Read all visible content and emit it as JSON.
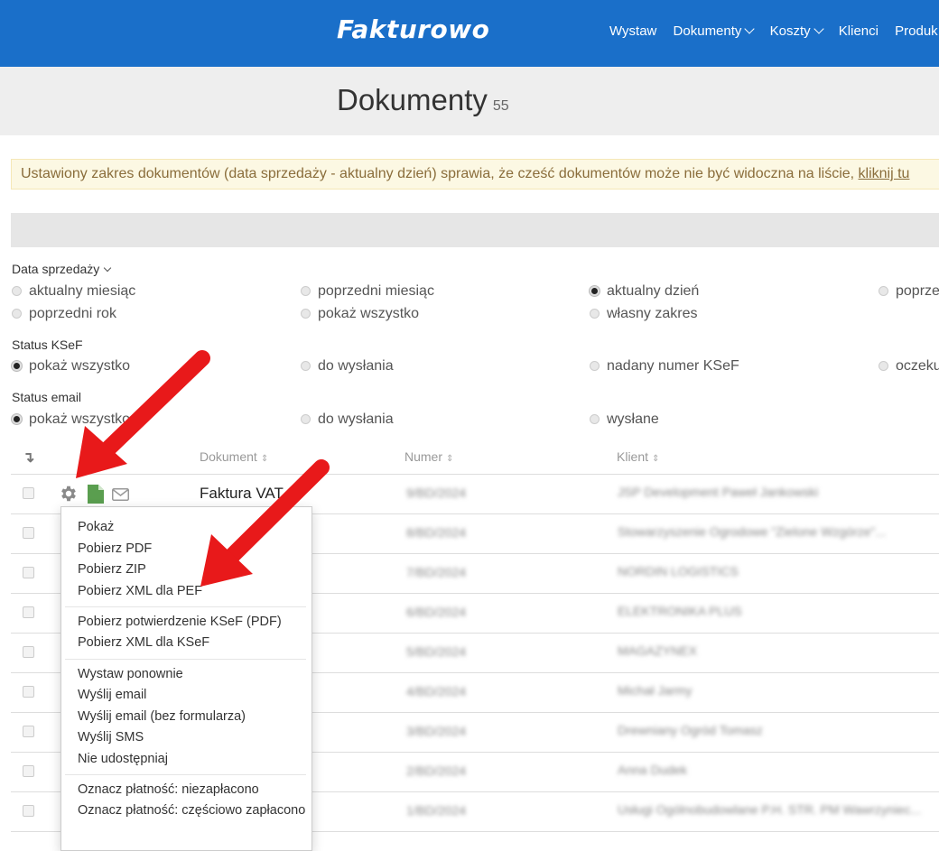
{
  "header": {
    "logo": "Fakturowo",
    "nav": [
      "Wystaw",
      "Dokumenty",
      "Koszty",
      "Klienci",
      "Produk"
    ]
  },
  "page": {
    "title": "Dokumenty",
    "count": "55"
  },
  "alert": {
    "text": "Ustawiony zakres dokumentów (data sprzedaży - aktualny dzień) sprawia, że cześć dokumentów może nie być widoczna na liście, ",
    "link": "kliknij tu"
  },
  "filters": {
    "sale_date": {
      "label": "Data sprzedaży",
      "options": [
        "aktualny miesiąc",
        "poprzedni miesiąc",
        "aktualny dzień",
        "poprze",
        "poprzedni rok",
        "pokaż wszystko",
        "własny zakres"
      ],
      "selected": "aktualny dzień"
    },
    "ksef": {
      "label": "Status KSeF",
      "options": [
        "pokaż wszystko",
        "do wysłania",
        "nadany numer KSeF",
        "oczeku"
      ],
      "selected": "pokaż wszystko"
    },
    "email": {
      "label": "Status email",
      "options": [
        "pokaż wszystko",
        "do wysłania",
        "wysłane"
      ],
      "selected": "pokaż wszystko"
    }
  },
  "table": {
    "headers": [
      "Dokument",
      "Numer",
      "Klient"
    ],
    "first_document": "Faktura VAT",
    "rows": [
      {
        "numer": "9/BD/2024",
        "klient": "JSP Development Paweł Jankowski"
      },
      {
        "numer": "8/BD/2024",
        "klient": "Stowarzyszenie Ogrodowe \"Zielone Wzgórze\"..."
      },
      {
        "numer": "7/BD/2024",
        "klient": "NORDIN LOGISTICS"
      },
      {
        "numer": "6/BD/2024",
        "klient": "ELEKTRONIKA PLUS"
      },
      {
        "numer": "5/BD/2024",
        "klient": "MAGAZYNEX"
      },
      {
        "numer": "4/BD/2024",
        "klient": "Michał Jarmy"
      },
      {
        "numer": "3/BD/2024",
        "klient": "Drewniany Ogród Tomasz"
      },
      {
        "numer": "2/BD/2024",
        "klient": "Anna Dudek"
      },
      {
        "numer": "1/BD/2024",
        "klient": "Usługi Ogólnobudowlane P.H. STR. PM Wawrzyniec..."
      }
    ]
  },
  "menu": {
    "items": [
      "Pokaż",
      "Pobierz PDF",
      "Pobierz ZIP",
      "Pobierz XML dla PEF",
      "Pobierz potwierdzenie KSeF (PDF)",
      "Pobierz XML dla KSeF",
      "Wystaw ponownie",
      "Wyślij email",
      "Wyślij email (bez formularza)",
      "Wyślij SMS",
      "Nie udostępniaj",
      "Oznacz płatność: niezapłacono",
      "Oznacz płatność: częściowo zapłacono"
    ]
  },
  "colors": {
    "brand": "#1a6fc9",
    "arrow": "#e8191a",
    "doc_icon": "#5a9e4f"
  }
}
